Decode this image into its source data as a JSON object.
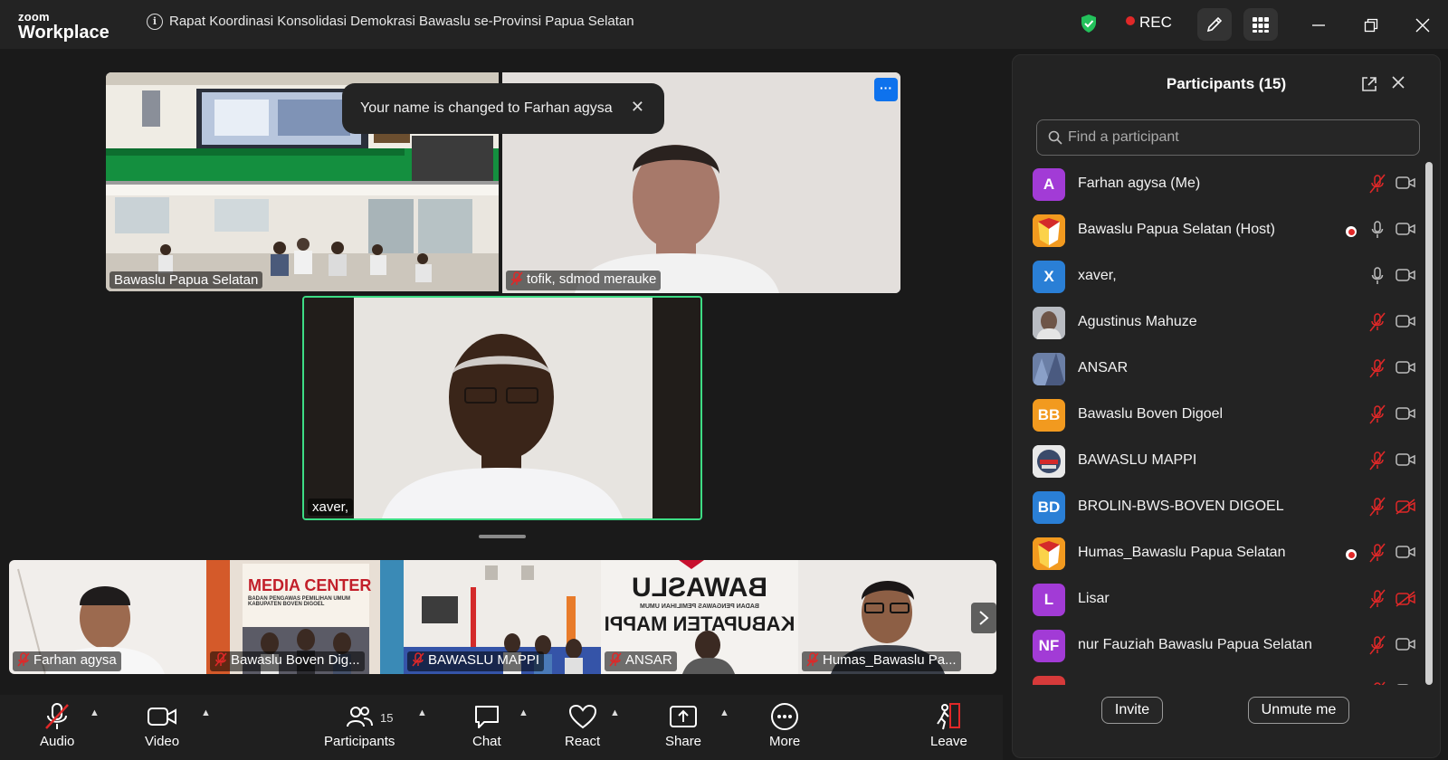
{
  "app": {
    "logo_line1": "zoom",
    "logo_line2": "Workplace"
  },
  "header": {
    "meeting_title": "Rapat Koordinasi Konsolidasi Demokrasi Bawaslu se-Provinsi Papua Selatan",
    "rec_label": "REC"
  },
  "toast": {
    "message": "Your name is changed to Farhan agysa"
  },
  "videos": {
    "main": [
      {
        "name": "Bawaslu Papua Selatan"
      },
      {
        "name": "tofik, sdmod merauke"
      },
      {
        "name": "xaver,"
      }
    ],
    "strip": [
      {
        "name": "Farhan agysa"
      },
      {
        "name": "Bawaslu Boven Dig..."
      },
      {
        "name": "BAWASLU MAPPI"
      },
      {
        "name": "ANSAR"
      },
      {
        "name": "Humas_Bawaslu Pa..."
      }
    ],
    "mappi_banner": {
      "top": "BAWASLU",
      "sub": "BADAN PENGAWAS PEMILIHAN UMUM",
      "bottom": "KABUPATEN MAPPI"
    },
    "boven_banner": {
      "title": "MEDIA CENTER",
      "sub": "BADAN PENGAWAS PEMILIHAN UMUM KABUPATEN BOVEN DIGOEL"
    }
  },
  "toolbar": {
    "audio": "Audio",
    "video": "Video",
    "participants": "Participants",
    "participants_count": "15",
    "chat": "Chat",
    "react": "React",
    "share": "Share",
    "more": "More",
    "leave": "Leave"
  },
  "panel": {
    "title": "Participants (15)",
    "search_placeholder": "Find a participant",
    "invite": "Invite",
    "unmute": "Unmute me",
    "participants": [
      {
        "name": "Farhan agysa (Me)",
        "initials": "A",
        "color": "#a23bd6",
        "mic": "muted",
        "cam": "on",
        "rec": false
      },
      {
        "name": "Bawaslu Papua Selatan (Host)",
        "initials": "",
        "color": "#f29a1f",
        "mic": "on",
        "cam": "on",
        "rec": true
      },
      {
        "name": "xaver,",
        "initials": "X",
        "color": "#2a7fd6",
        "mic": "on",
        "cam": "on",
        "rec": false
      },
      {
        "name": "Agustinus Mahuze",
        "initials": "",
        "color": "#9aa0a8",
        "mic": "muted",
        "cam": "on",
        "rec": false
      },
      {
        "name": "ANSAR",
        "initials": "",
        "color": "#6b7fa6",
        "mic": "muted",
        "cam": "on",
        "rec": false
      },
      {
        "name": "Bawaslu Boven Digoel",
        "initials": "BB",
        "color": "#f29a1f",
        "mic": "muted",
        "cam": "on",
        "rec": false
      },
      {
        "name": "BAWASLU MAPPI",
        "initials": "",
        "color": "#e8e8e8",
        "mic": "muted",
        "cam": "on",
        "rec": false
      },
      {
        "name": "BROLIN-BWS-BOVEN DIGOEL",
        "initials": "BD",
        "color": "#2a7fd6",
        "mic": "muted",
        "cam": "off",
        "rec": false
      },
      {
        "name": "Humas_Bawaslu Papua Selatan",
        "initials": "",
        "color": "#f29a1f",
        "mic": "muted",
        "cam": "on",
        "rec": true
      },
      {
        "name": "Lisar",
        "initials": "L",
        "color": "#a23bd6",
        "mic": "muted",
        "cam": "off",
        "rec": false
      },
      {
        "name": "nur Fauziah Bawaslu Papua Selatan",
        "initials": "NF",
        "color": "#a23bd6",
        "mic": "muted",
        "cam": "on",
        "rec": false
      },
      {
        "name": "",
        "initials": "",
        "color": "#d63a3a",
        "mic": "muted",
        "cam": "on",
        "rec": false
      }
    ]
  },
  "colors": {
    "accent": "#0e72ed",
    "active_speaker": "#3ddc84",
    "muted_red": "#e02828",
    "background": "#1a1a1a"
  }
}
